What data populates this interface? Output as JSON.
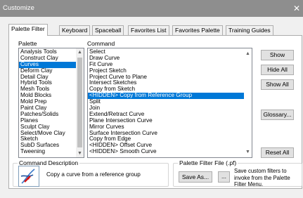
{
  "window": {
    "title": "Customize",
    "close_glyph": "✕"
  },
  "tabs": [
    "Palette Filter",
    "Keyboard",
    "Spaceball",
    "Favorites List",
    "Favorites Palette",
    "Training Guides"
  ],
  "palette": {
    "label": "Palette",
    "items": [
      "Analysis Tools",
      "Construct Clay",
      "Curves",
      "Deform Clay",
      "Detail Clay",
      "Hybrid Tools",
      "Mesh Tools",
      "Mold Blocks",
      "Mold Prep",
      "Paint Clay",
      "Patches/Solids",
      "Planes",
      "Sculpt Clay",
      "Select/Move Clay",
      "Sketch",
      "SubD Surfaces",
      "Tweening"
    ],
    "selected_index": 2
  },
  "command": {
    "label": "Command",
    "items": [
      "Select",
      "Draw Curve",
      "Fit Curve",
      "Project Sketch",
      "Project Curve to Plane",
      "Intersect Sketches",
      "Copy from Sketch",
      "<HIDDEN> Copy from Reference Group",
      "Split",
      "Join",
      "Extend/Retract Curve",
      "Plane Intersection Curve",
      "Mirror Curves",
      "Surface Intersection Curve",
      "Copy from Edge",
      "<HIDDEN> Offset Curve",
      "<HIDDEN> Smooth Curve"
    ],
    "selected_index": 7
  },
  "buttons": {
    "show": "Show",
    "hide_all": "Hide All",
    "show_all": "Show All",
    "glossary": "Glossary...",
    "reset_all": "Reset All",
    "save_as": "Save As...",
    "browse": "..."
  },
  "command_description": {
    "title": "Command Description",
    "text": "Copy a curve from a reference group",
    "icon": "curve-copy-icon"
  },
  "palette_filter_file": {
    "title": "Palette Filter File (.pf)",
    "note": "Save custom filters to invoke from the Palette Filter Menu."
  },
  "colors": {
    "selection": "#0078d7",
    "titlebar": "#8e8e8e"
  }
}
